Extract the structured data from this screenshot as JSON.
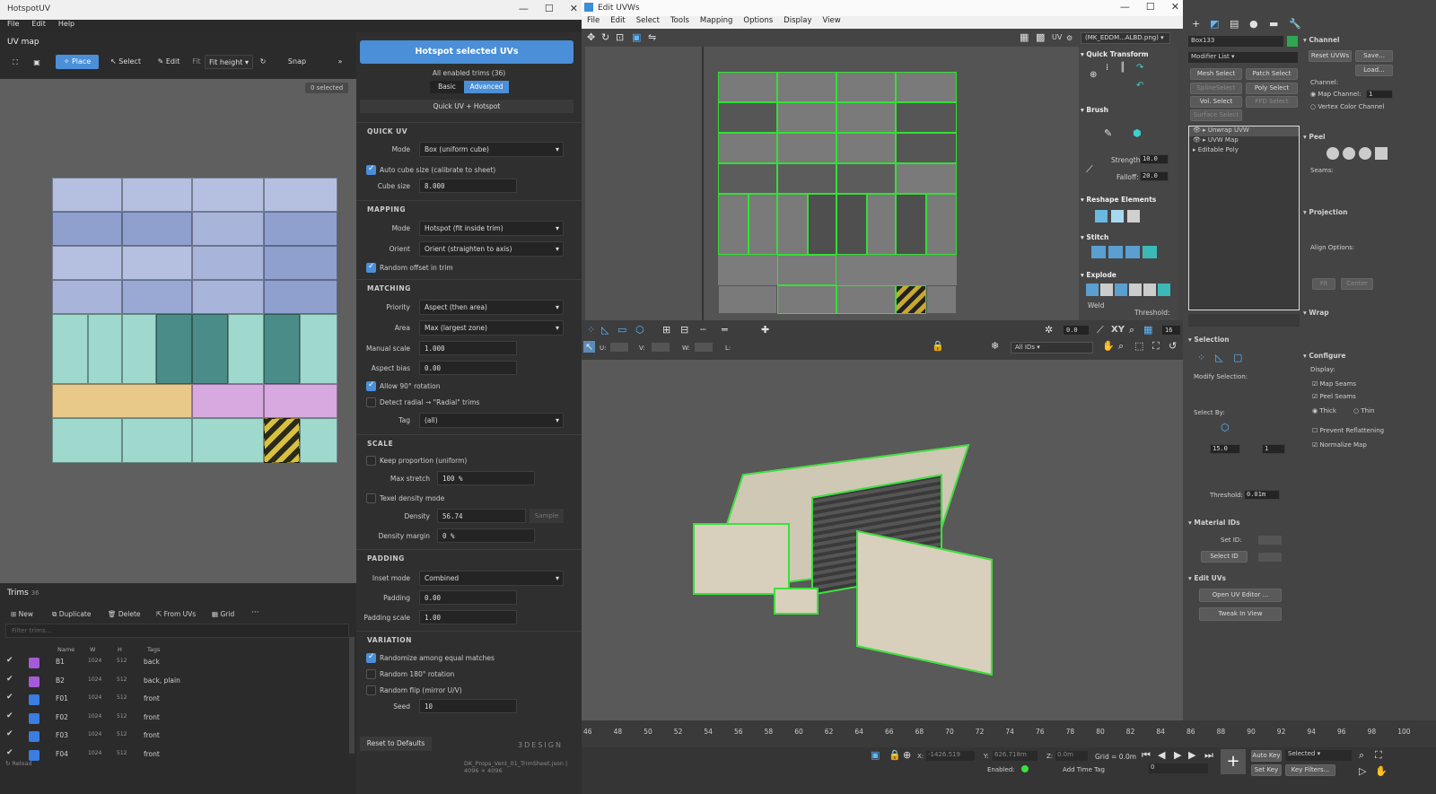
{
  "hotspot": {
    "title": "HotspotUV",
    "menu": [
      "File",
      "Edit",
      "Help"
    ],
    "uv_map_label": "UV map",
    "toolbar": {
      "place": "Place",
      "select": "Select",
      "edit": "Edit",
      "fit_label": "Fit",
      "fit_value": "Fit height",
      "snap": "Snap",
      "more": "»"
    },
    "selected_badge": "0 selected",
    "hotspot_button": "Hotspot selected UVs",
    "enabled_trims": "All enabled trims (36)",
    "mode_tabs": {
      "basic": "Basic",
      "advanced": "Advanced"
    },
    "quick_button": "Quick UV + Hotspot",
    "quick_uv": {
      "header": "QUICK UV",
      "mode_label": "Mode",
      "mode_value": "Box (uniform cube)",
      "auto_cube": "Auto cube size (calibrate to sheet)",
      "cube_size_label": "Cube size",
      "cube_size_value": "8.000"
    },
    "mapping": {
      "header": "MAPPING",
      "mode_label": "Mode",
      "mode_value": "Hotspot (fit inside trim)",
      "orient_label": "Orient",
      "orient_value": "Orient (straighten to axis)",
      "random_offset": "Random offset in trim"
    },
    "matching": {
      "header": "MATCHING",
      "priority_label": "Priority",
      "priority_value": "Aspect (then area)",
      "area_label": "Area",
      "area_value": "Max (largest zone)",
      "manual_scale_label": "Manual scale",
      "manual_scale_value": "1.000",
      "aspect_bias_label": "Aspect bias",
      "aspect_bias_value": "0.00",
      "allow_rotation": "Allow 90° rotation",
      "detect_radial": "Detect radial → \"Radial\" trims",
      "tag_label": "Tag",
      "tag_value": "(all)"
    },
    "scale": {
      "header": "SCALE",
      "keep_proportion": "Keep proportion (uniform)",
      "max_stretch_label": "Max stretch",
      "max_stretch_value": "100 %",
      "texel_density": "Texel density mode",
      "density_label": "Density",
      "density_value": "56.74",
      "sample": "Sample",
      "density_margin_label": "Density margin",
      "density_margin_value": "0 %"
    },
    "padding": {
      "header": "PADDING",
      "inset_label": "Inset mode",
      "inset_value": "Combined",
      "padding_label": "Padding",
      "padding_value": "0.00",
      "padding_scale_label": "Padding scale",
      "padding_scale_value": "1.00"
    },
    "variation": {
      "header": "VARIATION",
      "randomize": "Randomize among equal matches",
      "random180": "Random 180° rotation",
      "random_flip": "Random flip (mirror U/V)",
      "seed_label": "Seed",
      "seed_value": "10"
    },
    "reset": "Reset to Defaults",
    "brand": "3DESIGN",
    "trims": {
      "header": "Trims",
      "count": "36",
      "actions": [
        "New",
        "Duplicate",
        "Delete",
        "From UVs",
        "Grid",
        "···"
      ],
      "filter_placeholder": "Filter trims...",
      "columns": [
        "Name",
        "W",
        "H",
        "Tags"
      ],
      "rows": [
        {
          "name": "B1",
          "w": "1024",
          "h": "512",
          "tags": "back",
          "color": "#a55bd8"
        },
        {
          "name": "B2",
          "w": "1024",
          "h": "512",
          "tags": "back, plain",
          "color": "#a55bd8"
        },
        {
          "name": "F01",
          "w": "1024",
          "h": "512",
          "tags": "front",
          "color": "#3b7de0"
        },
        {
          "name": "F02",
          "w": "1024",
          "h": "512",
          "tags": "front",
          "color": "#3b7de0"
        },
        {
          "name": "F03",
          "w": "1024",
          "h": "512",
          "tags": "front",
          "color": "#3b7de0"
        },
        {
          "name": "F04",
          "w": "1024",
          "h": "512",
          "tags": "front",
          "color": "#3b7de0"
        }
      ]
    },
    "reload": "↻ Reload",
    "file_info": "DK_Props_Vent_01_TrimSheet.json | 4096 × 4096"
  },
  "edit_uvws": {
    "title": "Edit UVWs",
    "menu": [
      "File",
      "Edit",
      "Select",
      "Tools",
      "Mapping",
      "Options",
      "Display",
      "View"
    ],
    "uv_label": "UV",
    "texture_dropdown": "(MK_EDDM...ALBD.png)",
    "rollouts": {
      "quick_transform": "Quick Transform",
      "brush": "Brush",
      "strength_label": "Strength:",
      "strength_value": "10.0",
      "falloff_label": "Falloff:",
      "falloff_value": "20.0",
      "reshape": "Reshape Elements",
      "stitch": "Stitch",
      "explode": "Explode",
      "weld": "Weld",
      "threshold": "Threshold:"
    },
    "bottom": {
      "u": "U:",
      "v": "V:",
      "w": "W:",
      "l": "L:",
      "ids": "All IDs",
      "spin": "0.0",
      "num16": "16",
      "xy": "XY"
    }
  },
  "command_panel": {
    "object_name": "Box133",
    "modifier_list": "Modifier List",
    "buttons": [
      "Mesh Select",
      "Patch Select",
      "SplineSelect",
      "Poly Select",
      "Vol. Select",
      "FFD Select",
      "Surface Select"
    ],
    "stack": [
      "Unwrap UVW",
      "UVW Map",
      "Editable Poly"
    ],
    "channel": {
      "header": "Channel",
      "reset": "Reset UVWs",
      "save": "Save...",
      "load": "Load...",
      "channel_label": "Channel:",
      "map_channel": "Map Channel:",
      "map_channel_value": "1",
      "vertex_color": "Vertex Color Channel"
    },
    "peel": {
      "header": "Peel",
      "seams": "Seams:"
    },
    "projection": {
      "header": "Projection",
      "align": "Align Options:",
      "fit": "Fit",
      "center": "Center"
    },
    "wrap": {
      "header": "Wrap"
    },
    "configure": {
      "header": "Configure",
      "display": "Display:",
      "map_seams": "Map Seams",
      "peel_seams": "Peel Seams",
      "thick": "Thick",
      "thin": "Thin",
      "prevent": "Prevent Reflattening",
      "normalize": "Normalize Map"
    },
    "selection": {
      "header": "Selection",
      "modify": "Modify Selection:",
      "select_by": "Select By:",
      "angle": "15.0",
      "one": "1",
      "threshold": "Threshold:",
      "threshold_value": "0.01m"
    },
    "material": {
      "header": "Material IDs",
      "set_id": "Set ID:",
      "select_id": "Select ID"
    },
    "edit_uvs": {
      "header": "Edit UVs",
      "open": "Open UV Editor ...",
      "tweak": "Tweak In View"
    }
  },
  "timeline": {
    "ticks": [
      "46",
      "48",
      "50",
      "52",
      "54",
      "56",
      "58",
      "60",
      "62",
      "64",
      "66",
      "68",
      "70",
      "72",
      "74",
      "76",
      "78",
      "80",
      "82",
      "84",
      "86",
      "88",
      "90",
      "92",
      "94",
      "96",
      "98",
      "100"
    ]
  },
  "status": {
    "x_label": "X:",
    "x": "-1426.519",
    "y_label": "Y:",
    "y": "626.718m",
    "z_label": "Z:",
    "z": "0.0m",
    "grid": "Grid = 0.0m",
    "enabled": "Enabled:",
    "add_time_tag": "Add Time Tag",
    "auto_key": "Auto Key",
    "selected": "Selected",
    "set_key": "Set Key",
    "key_filters": "Key Filters...",
    "frame": "0"
  }
}
